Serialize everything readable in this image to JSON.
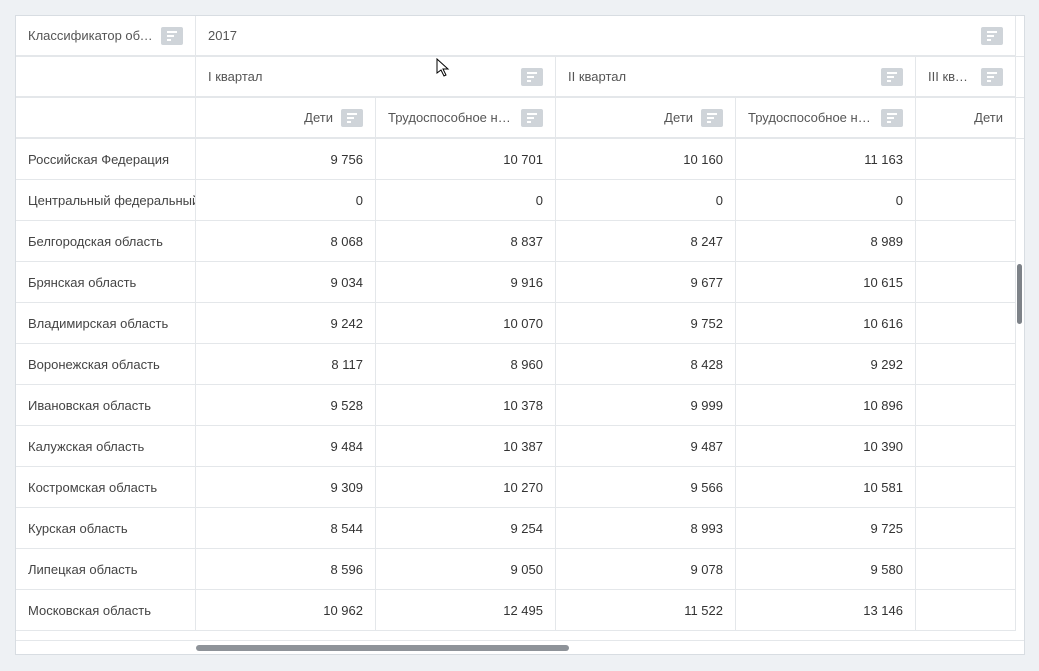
{
  "header": {
    "dim_label": "Классификатор объект...",
    "year": "2017",
    "quarters": [
      "I квартал",
      "II квартал",
      "III квартал"
    ],
    "measures": [
      "Дети",
      "Трудоспособное на...",
      "Дети",
      "Трудоспособное на...",
      "Дети"
    ]
  },
  "rows": [
    {
      "name": "Российская Федерация",
      "v": [
        "9 756",
        "10 701",
        "10 160",
        "11 163",
        ""
      ]
    },
    {
      "name": "Центральный федеральный...",
      "v": [
        "0",
        "0",
        "0",
        "0",
        ""
      ]
    },
    {
      "name": "Белгородская область",
      "v": [
        "8 068",
        "8 837",
        "8 247",
        "8 989",
        ""
      ]
    },
    {
      "name": "Брянская область",
      "v": [
        "9 034",
        "9 916",
        "9 677",
        "10 615",
        ""
      ]
    },
    {
      "name": "Владимирская область",
      "v": [
        "9 242",
        "10 070",
        "9 752",
        "10 616",
        ""
      ]
    },
    {
      "name": "Воронежская область",
      "v": [
        "8 117",
        "8 960",
        "8 428",
        "9 292",
        ""
      ]
    },
    {
      "name": "Ивановская область",
      "v": [
        "9 528",
        "10 378",
        "9 999",
        "10 896",
        ""
      ]
    },
    {
      "name": "Калужская область",
      "v": [
        "9 484",
        "10 387",
        "9 487",
        "10 390",
        ""
      ]
    },
    {
      "name": "Костромская область",
      "v": [
        "9 309",
        "10 270",
        "9 566",
        "10 581",
        ""
      ]
    },
    {
      "name": "Курская область",
      "v": [
        "8 544",
        "9 254",
        "8 993",
        "9 725",
        ""
      ]
    },
    {
      "name": "Липецкая область",
      "v": [
        "8 596",
        "9 050",
        "9 078",
        "9 580",
        ""
      ]
    },
    {
      "name": "Московская область",
      "v": [
        "10 962",
        "12 495",
        "11 522",
        "13 146",
        ""
      ]
    }
  ]
}
